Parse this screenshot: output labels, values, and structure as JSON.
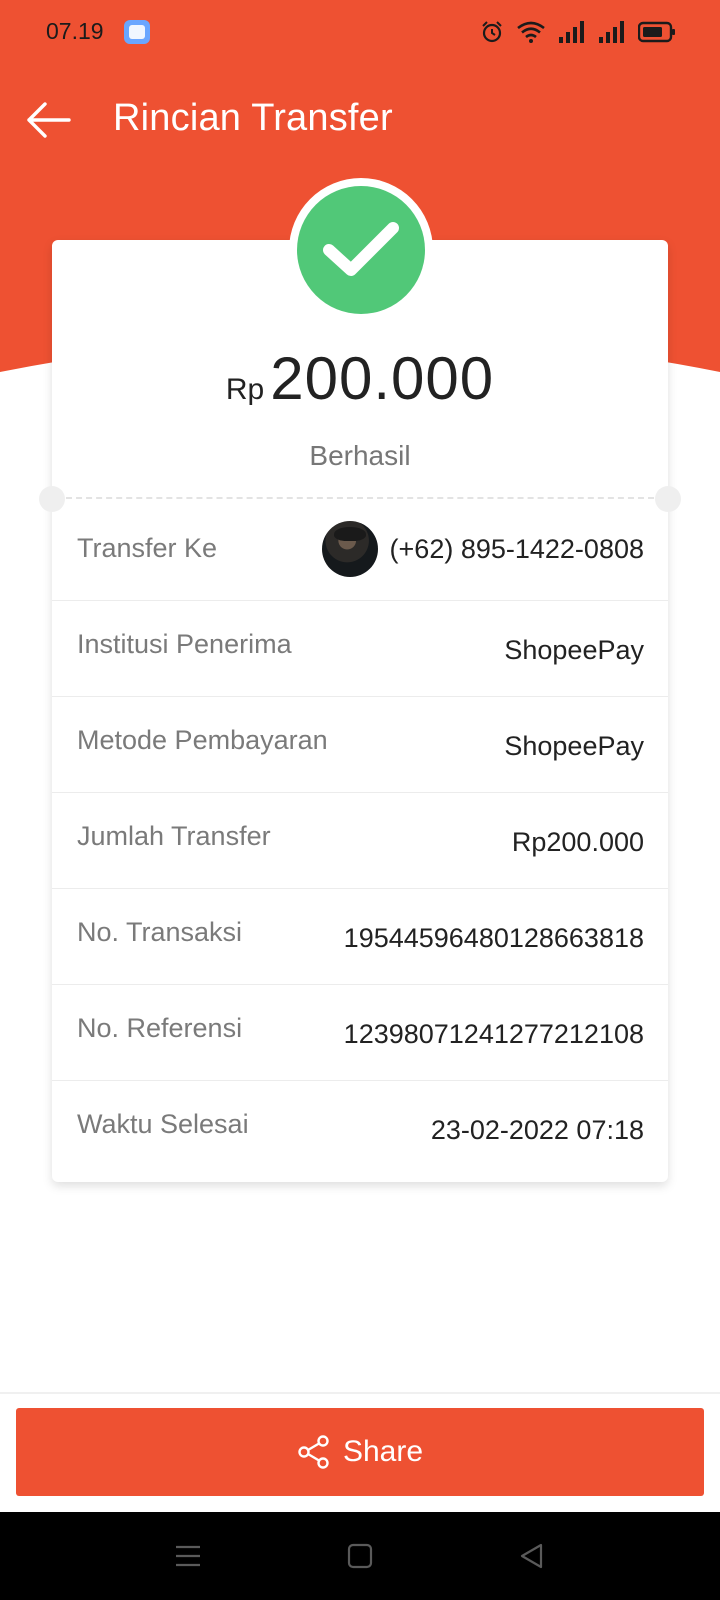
{
  "colors": {
    "brand": "#ee5132",
    "success": "#51c878",
    "label_text": "#7a7a7a",
    "value_text": "#222222"
  },
  "status_bar": {
    "time": "07.19",
    "icons": [
      "app-notification-icon",
      "alarm-icon",
      "wifi-icon",
      "signal-icon",
      "signal-icon",
      "battery-icon"
    ]
  },
  "app_bar": {
    "title": "Rincian Transfer",
    "back_icon": "arrow-left-icon"
  },
  "summary": {
    "currency": "Rp",
    "amount": "200.000",
    "status": "Berhasil",
    "status_icon": "checkmark-icon"
  },
  "details": {
    "rows": [
      {
        "label": "Transfer Ke",
        "value": "(+62) 895-1422-0808"
      },
      {
        "label": "Institusi Penerima",
        "value": "ShopeePay"
      },
      {
        "label": "Metode Pembayaran",
        "value": "ShopeePay"
      },
      {
        "label": "Jumlah Transfer",
        "value": "Rp200.000"
      },
      {
        "label": "No. Transaksi",
        "value": "195445964801286638​18"
      },
      {
        "label": "No. Referensi",
        "value": "123980712412772121​08"
      },
      {
        "label": "Waktu Selesai",
        "value": "23-02-2022 07:18"
      }
    ]
  },
  "footer": {
    "share_label": "Share",
    "share_icon": "share-icon"
  },
  "nav_bar": {
    "icons": [
      "menu-icon",
      "home-square-icon",
      "back-triangle-icon"
    ]
  }
}
